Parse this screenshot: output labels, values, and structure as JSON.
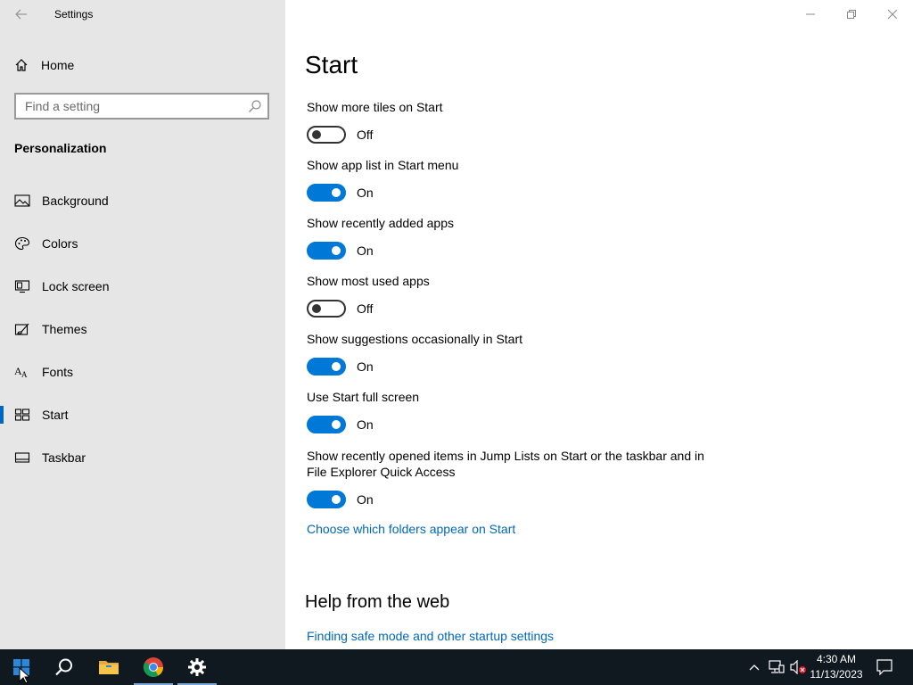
{
  "window": {
    "title": "Settings",
    "back_icon": "arrow-left-icon",
    "controls": [
      "minimize-icon",
      "restore-icon",
      "close-icon"
    ]
  },
  "sidebar": {
    "home_label": "Home",
    "search_placeholder": "Find a setting",
    "section_title": "Personalization",
    "items": [
      {
        "label": "Background",
        "icon": "picture-icon",
        "active": false
      },
      {
        "label": "Colors",
        "icon": "palette-icon",
        "active": false
      },
      {
        "label": "Lock screen",
        "icon": "monitor-icon",
        "active": false
      },
      {
        "label": "Themes",
        "icon": "brush-icon",
        "active": false
      },
      {
        "label": "Fonts",
        "icon": "font-icon",
        "active": false
      },
      {
        "label": "Start",
        "icon": "start-tiles-icon",
        "active": true
      },
      {
        "label": "Taskbar",
        "icon": "taskbar-icon",
        "active": false
      }
    ]
  },
  "main": {
    "title": "Start",
    "settings": [
      {
        "label": "Show more tiles on Start",
        "state": "Off"
      },
      {
        "label": "Show app list in Start menu",
        "state": "On"
      },
      {
        "label": "Show recently added apps",
        "state": "On"
      },
      {
        "label": "Show most used apps",
        "state": "Off"
      },
      {
        "label": "Show suggestions occasionally in Start",
        "state": "On"
      },
      {
        "label": "Use Start full screen",
        "state": "On"
      },
      {
        "label": "Show recently opened items in Jump Lists on Start or the taskbar and in File Explorer Quick Access",
        "state": "On"
      }
    ],
    "folders_link": "Choose which folders appear on Start",
    "help_title": "Help from the web",
    "help_link": "Finding safe mode and other startup settings"
  },
  "taskbar": {
    "apps": [
      "windows-start-icon",
      "search-icon",
      "file-explorer-icon",
      "chrome-icon",
      "settings-gear-icon"
    ],
    "tray": [
      "chevron-up-icon",
      "network-icon",
      "volume-muted-icon"
    ],
    "time": "4:30 AM",
    "date": "11/13/2023",
    "notification_icon": "action-center-icon",
    "accent": "#0078d7"
  }
}
